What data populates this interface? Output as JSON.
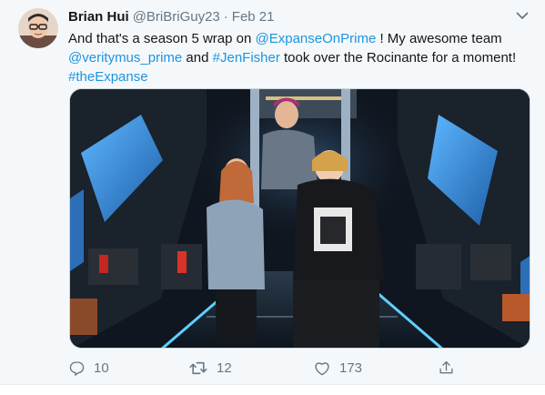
{
  "tweet": {
    "author_name": "Brian Hui",
    "author_handle": "@BriBriGuy23",
    "separator": "·",
    "date": "Feb 21",
    "text_parts": {
      "t1": "And that's a season 5 wrap on ",
      "m1": "@ExpanseOnPrime",
      "t2": " ! My awesome team ",
      "m2": "@veritymus_prime",
      "t3": " and ",
      "m3": "#JenFisher",
      "t4": " took over the Rocinante for a moment! ",
      "m4": "#theExpanse"
    },
    "actions": {
      "replies": "10",
      "retweets": "12",
      "likes": "173"
    }
  },
  "icons": {
    "more": "chevron-down-icon",
    "reply": "reply-icon",
    "retweet": "retweet-icon",
    "like": "heart-icon",
    "share": "share-icon"
  },
  "colors": {
    "link": "#1b95e0",
    "muted": "#657786",
    "text": "#14171a",
    "background": "#f5f8fa"
  }
}
